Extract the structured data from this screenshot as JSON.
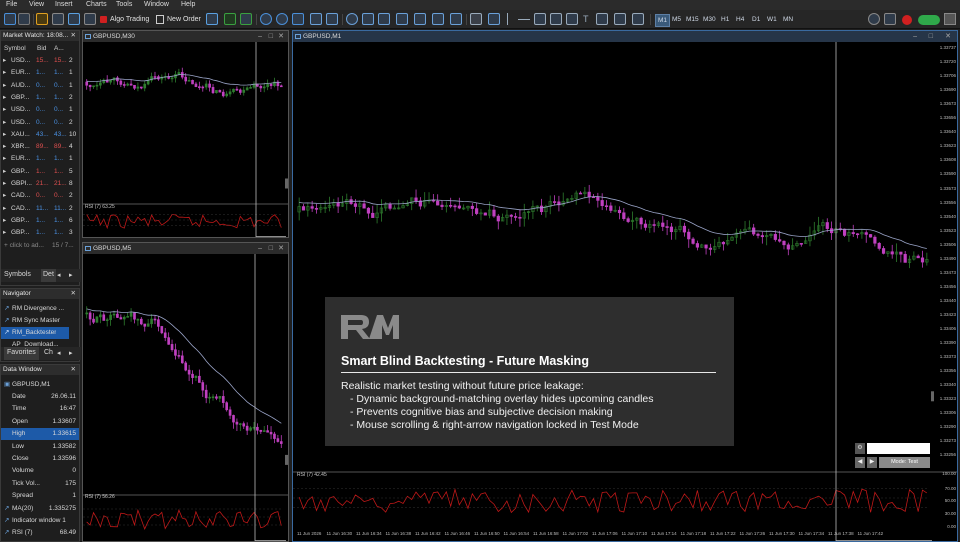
{
  "menu": [
    "File",
    "View",
    "Insert",
    "Charts",
    "Tools",
    "Window",
    "Help"
  ],
  "toolbar": {
    "algo_trading": "Algo Trading",
    "new_order": "New Order",
    "timeframes": [
      "M1",
      "M5",
      "M15",
      "M30",
      "H1",
      "H4",
      "D1",
      "W1",
      "MN"
    ],
    "active_timeframe": "M1"
  },
  "market_watch": {
    "title": "Market Watch: 18:08...",
    "columns": [
      "Symbol",
      "Bid",
      "A...",
      ""
    ],
    "rows": [
      {
        "symbol": "USD...",
        "bid": "15...",
        "ask": "15...",
        "spread": "2",
        "color": "#e05050"
      },
      {
        "symbol": "EUR...",
        "bid": "1...",
        "ask": "1...",
        "spread": "1",
        "color": "#4a90e2"
      },
      {
        "symbol": "AUD...",
        "bid": "0...",
        "ask": "0...",
        "spread": "1",
        "color": "#4a90e2"
      },
      {
        "symbol": "GBP...",
        "bid": "1...",
        "ask": "1...",
        "spread": "2",
        "color": "#4a90e2"
      },
      {
        "symbol": "USD...",
        "bid": "0...",
        "ask": "0...",
        "spread": "1",
        "color": "#4a90e2"
      },
      {
        "symbol": "USD...",
        "bid": "0...",
        "ask": "0...",
        "spread": "2",
        "color": "#4a90e2"
      },
      {
        "symbol": "XAU...",
        "bid": "43...",
        "ask": "43...",
        "spread": "10",
        "color": "#4a90e2"
      },
      {
        "symbol": "XBR...",
        "bid": "89...",
        "ask": "89...",
        "spread": "4",
        "color": "#e05050"
      },
      {
        "symbol": "EUR...",
        "bid": "1...",
        "ask": "1...",
        "spread": "1",
        "color": "#4a90e2"
      },
      {
        "symbol": "GBP...",
        "bid": "1...",
        "ask": "1...",
        "spread": "5",
        "color": "#e05050"
      },
      {
        "symbol": "GBPI...",
        "bid": "21...",
        "ask": "21...",
        "spread": "8",
        "color": "#e05050"
      },
      {
        "symbol": "CAD...",
        "bid": "0...",
        "ask": "0...",
        "spread": "2",
        "color": "#e05050"
      },
      {
        "symbol": "CAD...",
        "bid": "11...",
        "ask": "11...",
        "spread": "2",
        "color": "#4a90e2"
      },
      {
        "symbol": "GBP...",
        "bid": "1...",
        "ask": "1...",
        "spread": "6",
        "color": "#4a90e2"
      },
      {
        "symbol": "GBP...",
        "bid": "1...",
        "ask": "1...",
        "spread": "3",
        "color": "#4a90e2"
      }
    ],
    "add_text": "+ click to ad...",
    "count": "15 / 7...",
    "tabs": [
      "Symbols",
      "Det"
    ]
  },
  "navigator": {
    "title": "Navigator",
    "items": [
      "RM Divergence ...",
      "RM Sync Master",
      "RM_Backtester",
      "AP_Download..."
    ],
    "tabs": [
      "Favorites",
      "Ch"
    ]
  },
  "data_window": {
    "title": "Data Window",
    "symbol": "GBPUSD,M1",
    "rows": [
      {
        "label": "Date",
        "value": "26.06.11"
      },
      {
        "label": "Time",
        "value": "16:47"
      },
      {
        "label": "Open",
        "value": "1.33607"
      },
      {
        "label": "High",
        "value": "1.33615"
      },
      {
        "label": "Low",
        "value": "1.33582"
      },
      {
        "label": "Close",
        "value": "1.33596"
      },
      {
        "label": "Volume",
        "value": "0"
      },
      {
        "label": "Tick Vol...",
        "value": "175"
      },
      {
        "label": "Spread",
        "value": "1"
      },
      {
        "label": "MA(20)",
        "value": "1.335275"
      },
      {
        "label": "Indicator window 1",
        "value": ""
      },
      {
        "label": "RSI (7)",
        "value": "68.49"
      }
    ]
  },
  "chart_m30": {
    "title": "GBPUSD,M30",
    "rsi_label": "RSI (7) 63.25"
  },
  "chart_m5": {
    "title": "GBPUSD,M5",
    "rsi_label": "RSI (7) 56.26"
  },
  "chart_m1": {
    "title": "GBPUSD,M1",
    "rsi_label": "RSI (7) 42.45",
    "price_labels": [
      "1.33737",
      "1.33720",
      "1.33706",
      "1.33690",
      "1.33673",
      "1.33656",
      "1.33640",
      "1.33623",
      "1.33608",
      "1.33590",
      "1.33573",
      "1.33556",
      "1.33540",
      "1.33523",
      "1.33506",
      "1.33490",
      "1.33473",
      "1.33456",
      "1.33440",
      "1.33423",
      "1.33406",
      "1.33390",
      "1.33373",
      "1.33356",
      "1.33340",
      "1.33323",
      "1.33306",
      "1.33290",
      "1.33273",
      "1.33256"
    ],
    "rsi_levels": [
      "100.00",
      "70.00",
      "50.00",
      "30.00",
      "0.00"
    ],
    "time_labels": [
      "11 Jun 2026",
      "11 Jun 16:30",
      "11 Jun 16:34",
      "11 Jun 16:38",
      "11 Jun 16:42",
      "11 Jun 16:46",
      "11 Jun 16:50",
      "11 Jun 16:54",
      "11 Jun 16:58",
      "11 Jun 17:02",
      "11 Jun 17:06",
      "11 Jun 17:10",
      "11 Jun 17:14",
      "11 Jun 17:18",
      "11 Jun 17:22",
      "11 Jun 17:26",
      "11 Jun 17:30",
      "11 Jun 17:34",
      "11 Jun 17:38",
      "11 Jun 17:42"
    ],
    "test_button": "Mode: Test"
  },
  "overlay": {
    "title": "Smart Blind Backtesting - Future Masking",
    "subtitle": "Realistic market testing without future price leakage:",
    "bullets": [
      "- Dynamic background-matching overlay hides upcoming candles",
      "- Prevents cognitive bias and subjective decision making",
      "- Mouse scrolling & right-arrow navigation locked in Test Mode"
    ]
  },
  "colors": {
    "bull": "#2e7d2e",
    "bear": "#c040c0",
    "ma": "#9aa4c8",
    "rsi": "#c01818",
    "accent": "#1d5aa8"
  }
}
